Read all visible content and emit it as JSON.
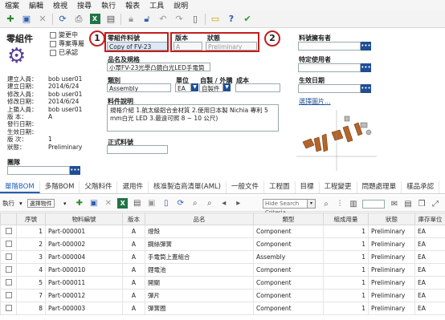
{
  "menu": [
    "檔案",
    "編輯",
    "檢視",
    "搜尋",
    "執行",
    "報表",
    "工具",
    "說明"
  ],
  "toolbar_icons": [
    "new-icon",
    "save-icon",
    "delete-icon",
    "refresh-icon",
    "print-icon",
    "excel-icon",
    "export-icon",
    "lock-icon",
    "unlock-icon",
    "undo-icon",
    "redo-icon",
    "revise-icon",
    "panel-icon",
    "help-icon",
    "check-icon"
  ],
  "part": {
    "title": "零組件",
    "flags": {
      "changing": "變更中",
      "exclusive": "專案專屬",
      "approved": "已承認"
    },
    "info": [
      {
        "k": "建立人員：",
        "v": "bob user01"
      },
      {
        "k": "建立日期：",
        "v": "2014/6/24"
      },
      {
        "k": "修改人員：",
        "v": "bob user01"
      },
      {
        "k": "修改日期：",
        "v": "2014/6/24"
      },
      {
        "k": "上鎖人員：",
        "v": "bob user01"
      },
      {
        "k": "版 本：",
        "v": "A"
      },
      {
        "k": "發行日期：",
        "v": ""
      },
      {
        "k": "生效日期：",
        "v": ""
      },
      {
        "k": "版 次：",
        "v": "1"
      },
      {
        "k": "狀態：",
        "v": "Preliminary"
      }
    ],
    "group_label": "團隊",
    "part_number_label": "零組件料號",
    "part_number_value": "Copy of FV-23",
    "version_label": "版本",
    "version_value": "A",
    "status_label": "狀態",
    "status_value": "Preliminary",
    "name_label": "品名及規格",
    "name_value": "小眾FV-23光學凸鏡白光LED手電筒",
    "category_label": "類別",
    "category_value": "Assembly",
    "unit_label": "單位",
    "unit_value": "EA",
    "make_buy_label": "自製 / 外購",
    "make_buy_value": "自製件",
    "cost_label": "成本",
    "cost_value": "",
    "description_label": "料件說明",
    "description_value": "規格介紹 1.航太級鋁合金材質 2.使用日本製 Nichia 專利 5 mm白光 LED 3.最遠可照 8 ~ 10 公尺)",
    "formal_label": "正式料號",
    "formal_value": "",
    "owner_label": "料號擁有者",
    "specific_user_label": "特定使用者",
    "effective_label": "生效日期",
    "select_image_link": "選擇圖片...",
    "callout_1": "1",
    "callout_2": "2"
  },
  "tabs": [
    "單階BOM",
    "多階BOM",
    "父階料件",
    "選用件",
    "核准製造商清單(AML)",
    "一般文件",
    "工程圖",
    "目標",
    "工程變更",
    "問題處理單",
    "樣品承認"
  ],
  "grid_toolbar": {
    "exec_label": "執行",
    "select_label": "選擇物件",
    "search_placeholder": "Hide Search Criteria"
  },
  "columns": [
    "序號",
    "物料編號",
    "版本",
    "品名",
    "類型",
    "組成用量",
    "狀態",
    "庫存單位"
  ],
  "rows": [
    {
      "seq": "1",
      "num": "Part-000001",
      "ver": "A",
      "name": "燈殼",
      "type": "Component",
      "qty": "1",
      "status": "Preliminary",
      "uom": "EA"
    },
    {
      "seq": "2",
      "num": "Part-000002",
      "ver": "A",
      "name": "鋼絲彈簧",
      "type": "Component",
      "qty": "1",
      "status": "Preliminary",
      "uom": "EA"
    },
    {
      "seq": "3",
      "num": "Part-000004",
      "ver": "A",
      "name": "手電筒上蓋組合",
      "type": "Assembly",
      "qty": "1",
      "status": "Preliminary",
      "uom": "EA"
    },
    {
      "seq": "4",
      "num": "Part-000010",
      "ver": "A",
      "name": "鋰電池",
      "type": "Component",
      "qty": "1",
      "status": "Preliminary",
      "uom": "EA"
    },
    {
      "seq": "5",
      "num": "Part-000011",
      "ver": "A",
      "name": "開關",
      "type": "Component",
      "qty": "1",
      "status": "Preliminary",
      "uom": "EA"
    },
    {
      "seq": "7",
      "num": "Part-000012",
      "ver": "A",
      "name": "彈片",
      "type": "Component",
      "qty": "1",
      "status": "Preliminary",
      "uom": "EA"
    },
    {
      "seq": "8",
      "num": "Part-000003",
      "ver": "A",
      "name": "彈簧圈",
      "type": "Component",
      "qty": "1",
      "status": "Preliminary",
      "uom": "EA"
    }
  ]
}
